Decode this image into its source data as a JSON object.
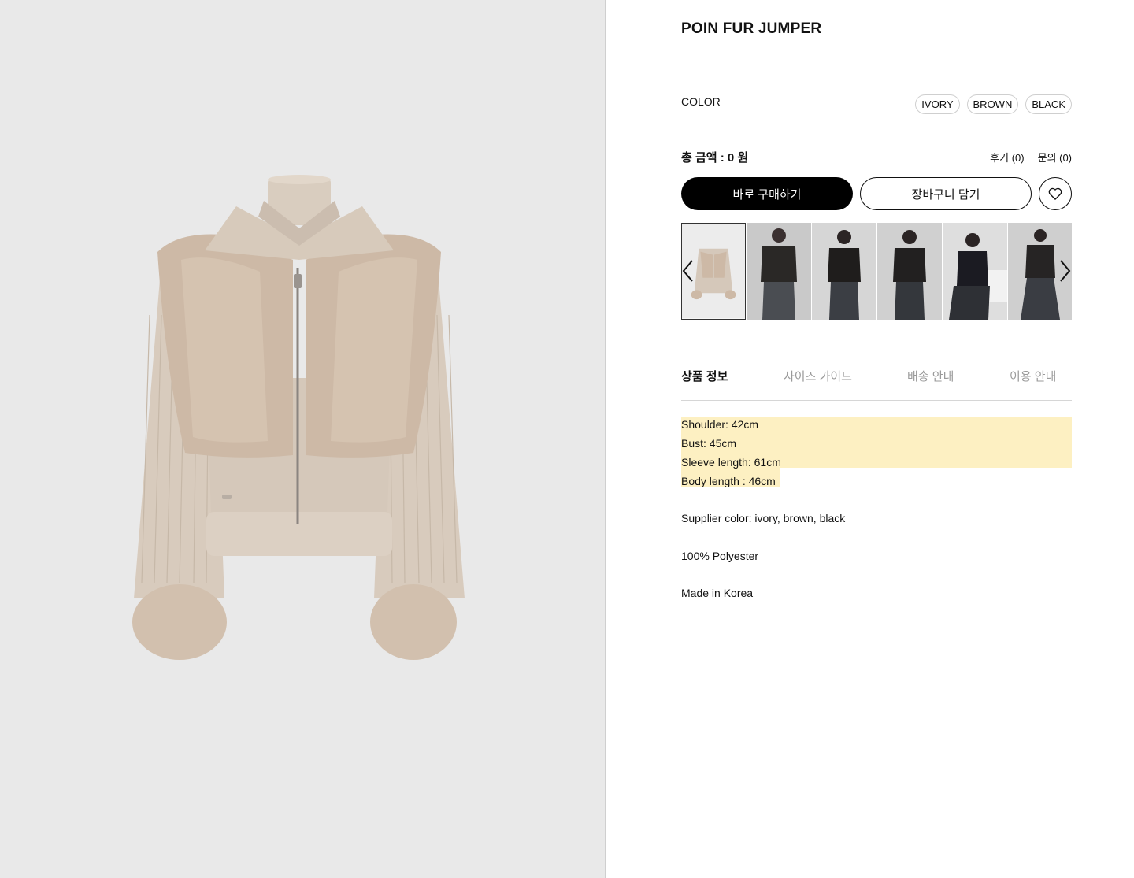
{
  "product": {
    "title": "POIN FUR JUMPER"
  },
  "options": {
    "color_label": "COLOR",
    "colors": [
      "IVORY",
      "BROWN",
      "BLACK"
    ]
  },
  "summary": {
    "total_price": "총 금액 : 0 원",
    "reviews": "후기 (0)",
    "inquiries": "문의 (0)"
  },
  "actions": {
    "buy_now": "바로 구매하기",
    "add_to_cart": "장바구니 담기",
    "wishlist_icon": "heart-icon"
  },
  "gallery": {
    "thumbnail_count": 6,
    "selected_index": 0,
    "prev_icon": "chevron-left-icon",
    "next_icon": "chevron-right-icon"
  },
  "tabs": [
    "상품 정보",
    "사이즈 가이드",
    "배송 안내",
    "이용 안내"
  ],
  "details": {
    "measurements": [
      "Shoulder: 42cm",
      "Bust: 45cm",
      "Sleeve length: 61cm",
      "Body length : 46cm"
    ],
    "supplier_color": "Supplier color: ivory, brown, black",
    "material": "100% Polyester",
    "origin": "Made in Korea"
  },
  "colors": {
    "hero_bg": "#e9e9e9",
    "highlight": "#fdf0c2",
    "primary_button": "#000000"
  }
}
